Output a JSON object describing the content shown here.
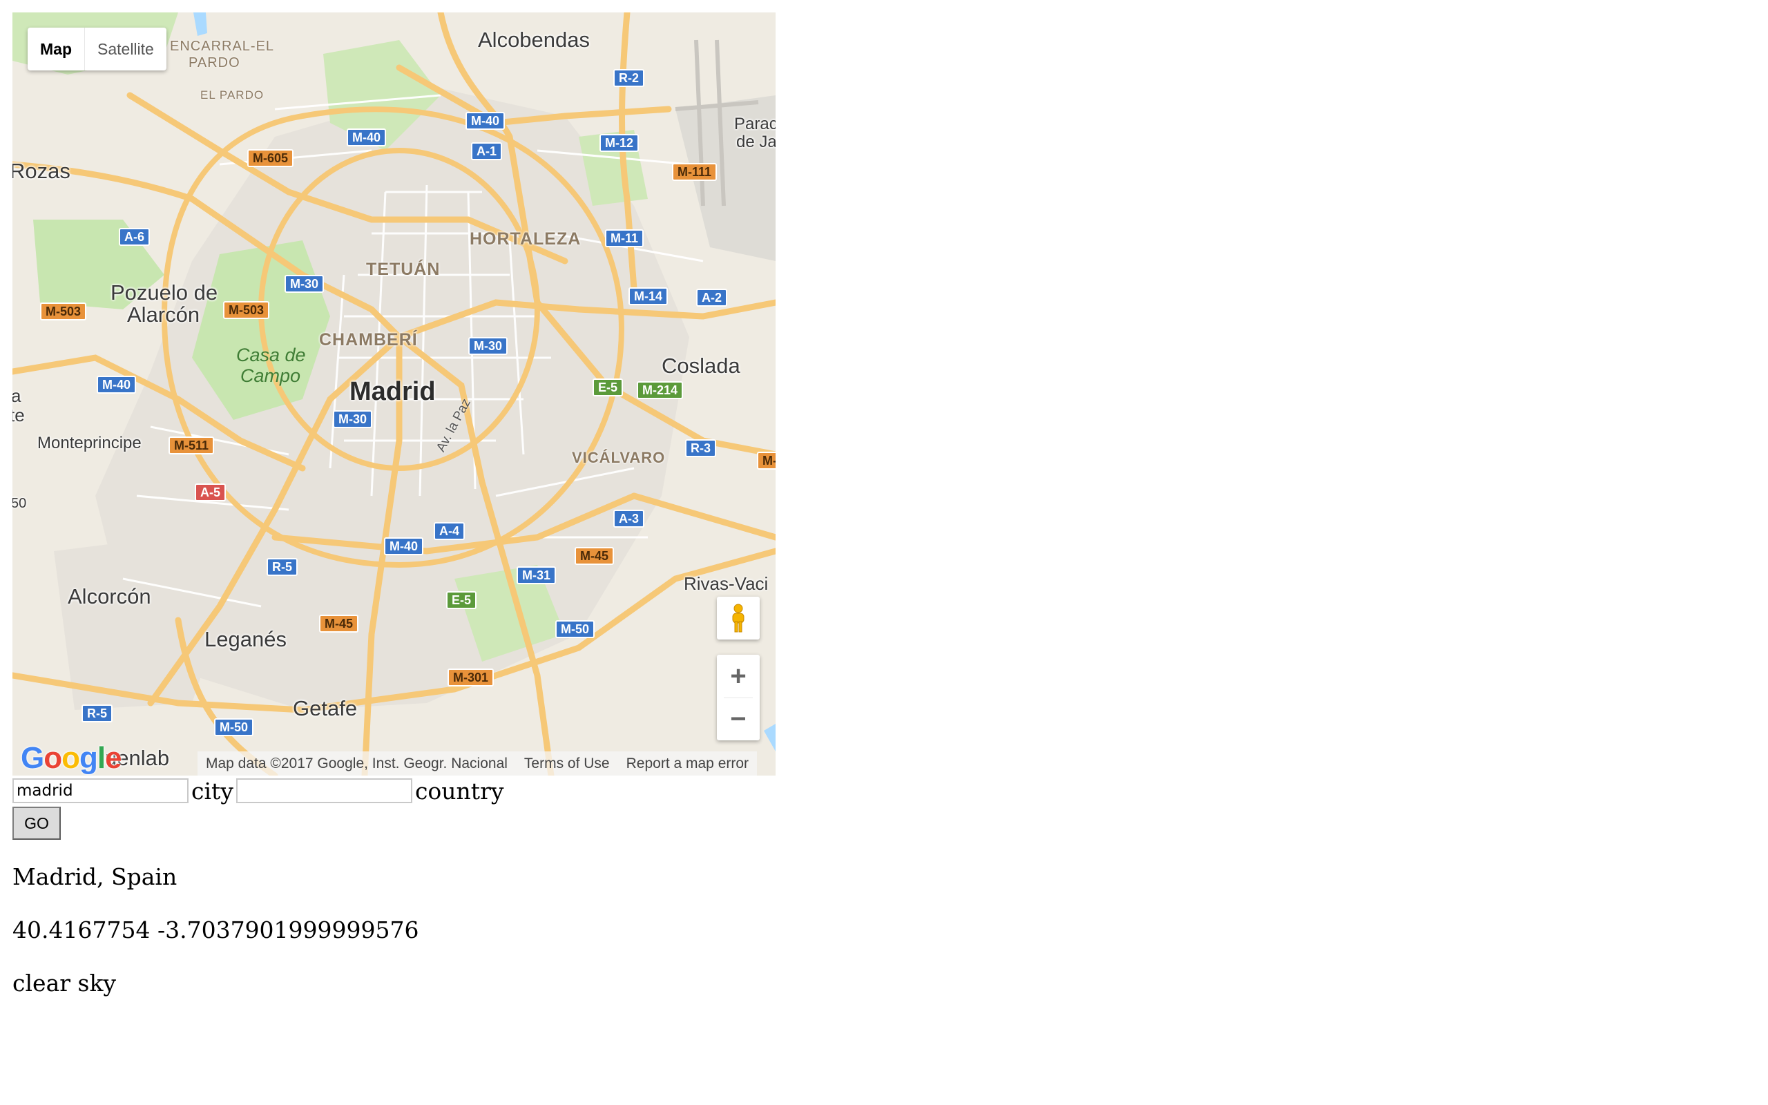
{
  "map": {
    "type_control": {
      "map_label": "Map",
      "satellite_label": "Satellite",
      "active": "Map"
    },
    "labels": {
      "alcobendas": "Alcobendas",
      "encarral": "ENCARRAL-EL",
      "pardo": "PARDO",
      "el_pardo": "EL PARDO",
      "rozas": "Rozas",
      "parac": "Parac",
      "de_ja": "de Ja",
      "hortaleza": "HORTALEZA",
      "tetuan": "TETUÁN",
      "pozuelo": "Pozuelo de",
      "alarcon": "Alarcón",
      "chamberi": "CHAMBERÍ",
      "casa_de": "Casa de",
      "campo": "Campo",
      "madrid": "Madrid",
      "coslada": "Coslada",
      "monteprincipe": "Monteprincipe",
      "av_la_paz": "Av. la Paz",
      "vicalvaro": "VICÁLVARO",
      "alcorcon": "Alcorcón",
      "rivas": "Rivas-Vaci",
      "leganes": "Leganés",
      "getafe": "Getafe",
      "fuenlab": "uenlab",
      "edge_a": "a",
      "edge_te": "te",
      "edge_50": "50"
    },
    "shields": {
      "r2": "R-2",
      "m40a": "M-40",
      "m40b": "M-40",
      "a1": "A-1",
      "m12": "M-12",
      "m605": "M-605",
      "m111": "M-111",
      "a6": "A-6",
      "m11": "M-11",
      "m30a": "M-30",
      "m503a": "M-503",
      "m503b": "M-503",
      "m14": "M-14",
      "a2": "A-2",
      "m30b": "M-30",
      "m40c": "M-40",
      "e5a": "E-5",
      "m214": "M-214",
      "m30c": "M-30",
      "m511": "M-511",
      "r3": "R-3",
      "m_edge": "M-",
      "a5": "A-5",
      "a3": "A-3",
      "a4": "A-4",
      "m40d": "M-40",
      "m45a": "M-45",
      "r5a": "R-5",
      "m31": "M-31",
      "e5b": "E-5",
      "m45b": "M-45",
      "m50a": "M-50",
      "m301": "M-301",
      "r5b": "R-5",
      "m50b": "M-50"
    },
    "zoom_in": "+",
    "zoom_out": "−",
    "logo": {
      "g1": "G",
      "o1": "o",
      "o2": "o",
      "g2": "g",
      "l": "l",
      "e": "e"
    },
    "attribution": {
      "data": "Map data ©2017 Google, Inst. Geogr. Nacional",
      "terms": "Terms of Use",
      "report": "Report a map error"
    },
    "colors": {
      "land": "#efebe2",
      "urban": "#e4e1dc",
      "park": "#c8e6b0",
      "road": "#f6c877",
      "water": "#aadaff"
    }
  },
  "form": {
    "city_value": "madrid",
    "city_label": "city",
    "country_value": "",
    "country_label": "country",
    "go_label": "GO"
  },
  "results": {
    "place": "Madrid, Spain",
    "coords": "40.4167754 -3.7037901999999576",
    "weather": "clear sky"
  }
}
